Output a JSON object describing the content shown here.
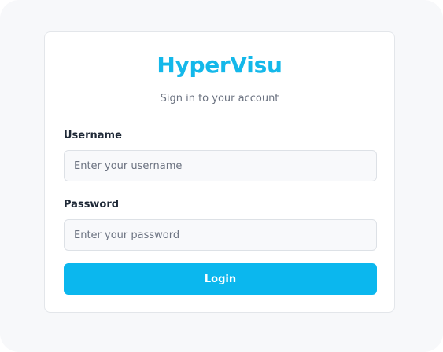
{
  "brand": {
    "name": "HyperVisu",
    "color": "#14b8ea"
  },
  "subtitle": "Sign in to your account",
  "form": {
    "username": {
      "label": "Username",
      "value": "",
      "placeholder": "Enter your username"
    },
    "password": {
      "label": "Password",
      "value": "",
      "placeholder": "Enter your password"
    },
    "submit_label": "Login",
    "submit_color": "#0bb7ee"
  }
}
